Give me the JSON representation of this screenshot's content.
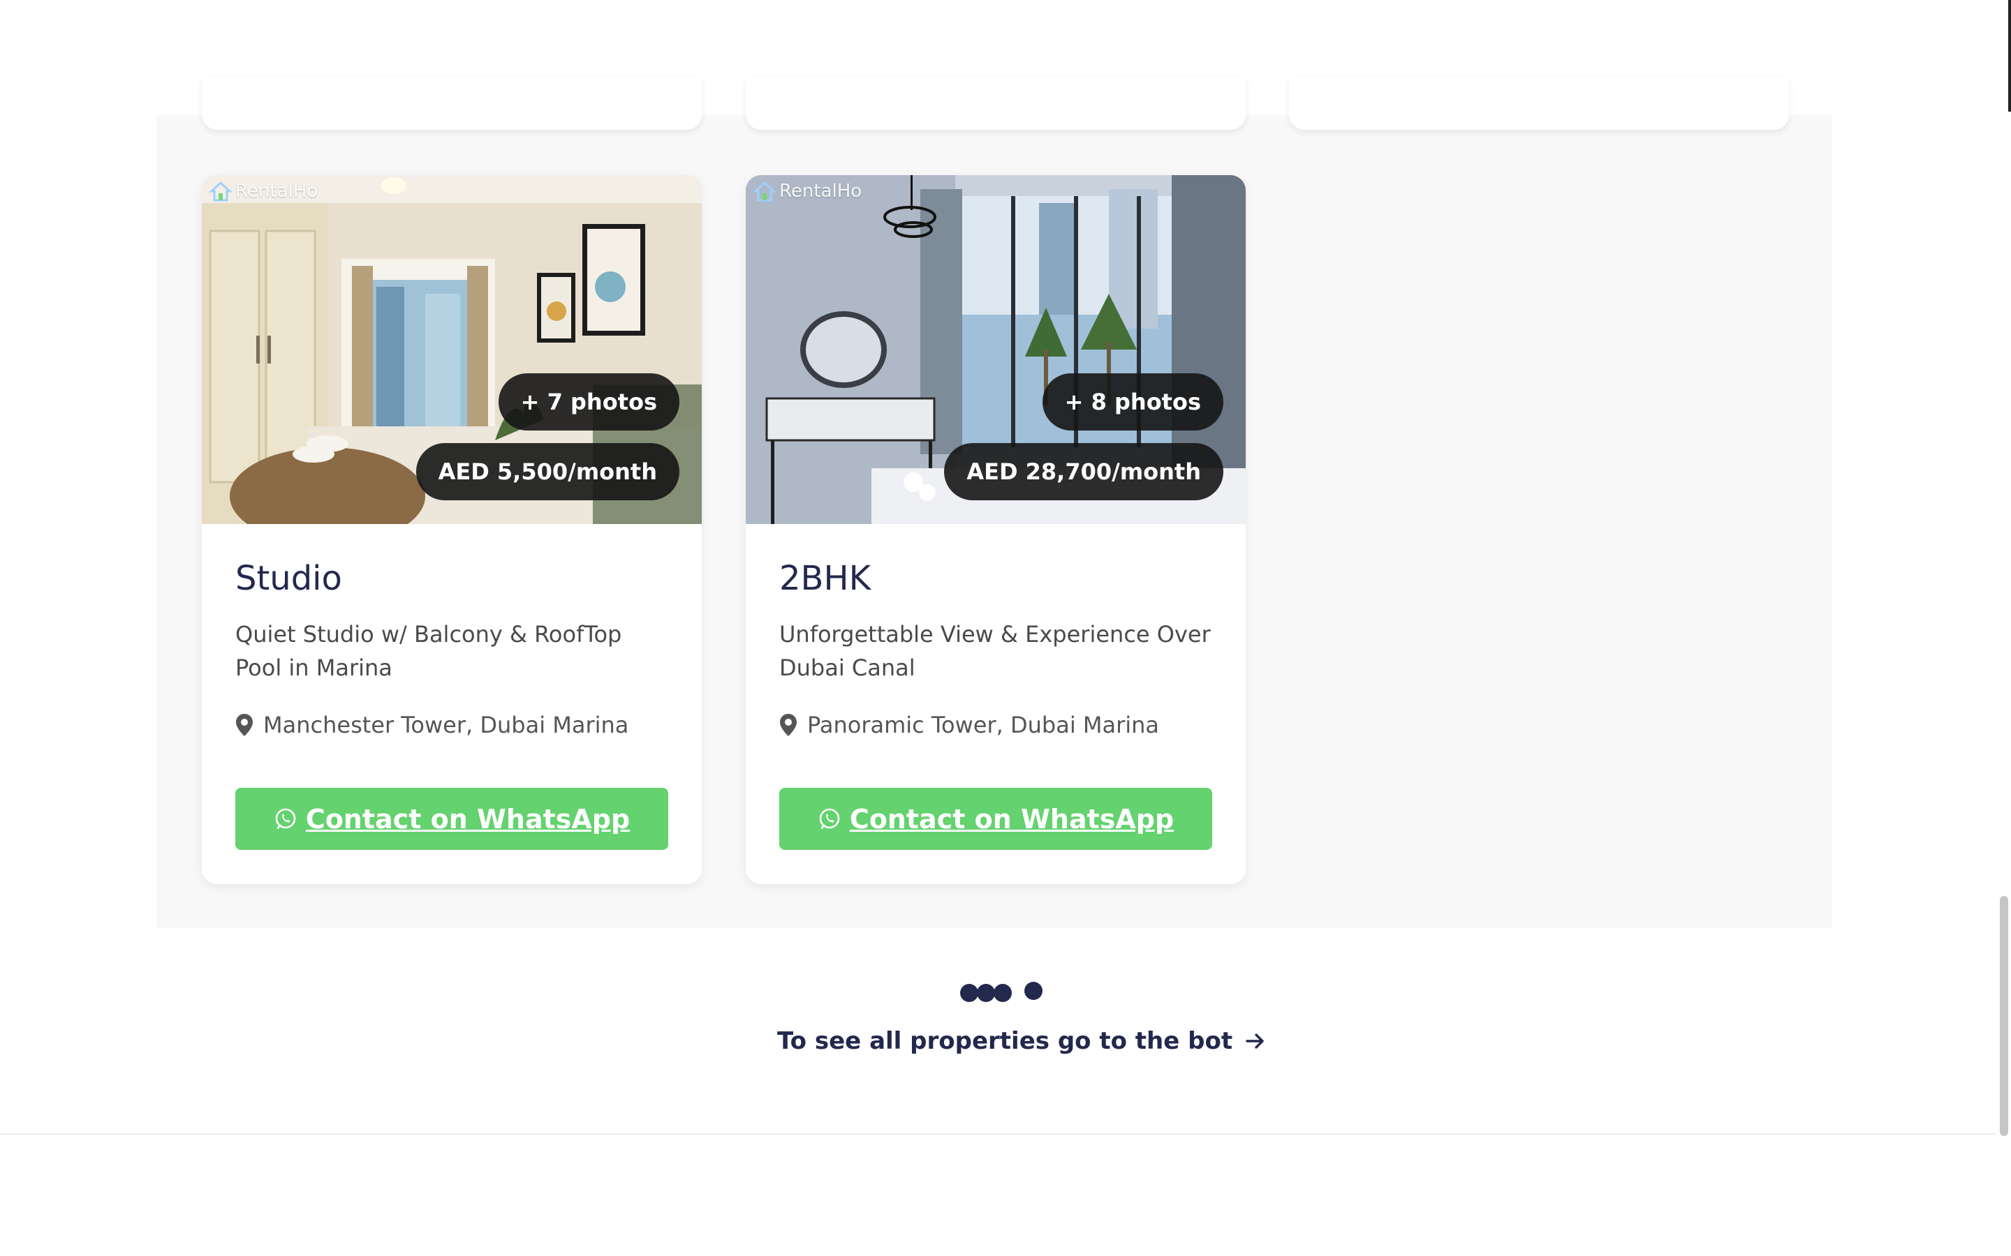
{
  "brand": {
    "watermark": "RentalHo"
  },
  "listings": [
    {
      "photos_label": "+ 7 photos",
      "price": "AED 5,500/month",
      "title": "Studio",
      "description": "Quiet Studio w/ Balcony & RoofTop Pool in Marina",
      "location": "Manchester Tower, Dubai Marina",
      "cta": "Contact on WhatsApp"
    },
    {
      "photos_label": "+ 8 photos",
      "price": "AED 28,700/month",
      "title": "2BHK",
      "description": "Unforgettable View & Experience Over Dubai Canal",
      "location": "Panoramic Tower, Dubai Marina",
      "cta": "Contact on WhatsApp"
    }
  ],
  "footer_link": "To see all properties go to the bot",
  "icons": {
    "location": "map-pin-icon",
    "whatsapp": "whatsapp-icon",
    "arrow": "arrow-right-icon",
    "brand": "house-logo-icon"
  },
  "colors": {
    "accent_green": "#64d26e",
    "navy": "#23294d",
    "pill_bg": "#161616"
  }
}
